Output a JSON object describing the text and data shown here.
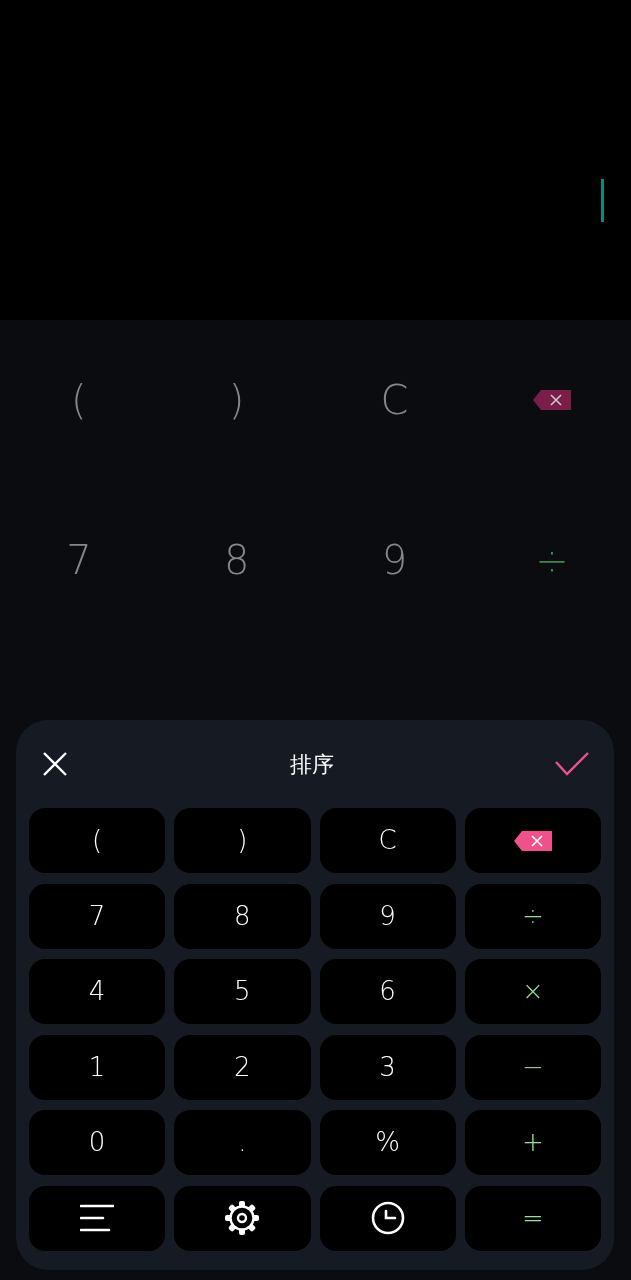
{
  "background_keypad": {
    "keys": [
      {
        "kind": "text",
        "label": "("
      },
      {
        "kind": "text",
        "label": ")"
      },
      {
        "kind": "text",
        "label": "C"
      },
      {
        "kind": "backspace"
      },
      {
        "kind": "text",
        "label": "7"
      },
      {
        "kind": "text",
        "label": "8"
      },
      {
        "kind": "text",
        "label": "9"
      },
      {
        "kind": "op",
        "label": "÷"
      }
    ]
  },
  "sheet": {
    "title": "排序",
    "keys": [
      {
        "kind": "text",
        "label": "("
      },
      {
        "kind": "text",
        "label": ")"
      },
      {
        "kind": "text",
        "label": "C"
      },
      {
        "kind": "backspace"
      },
      {
        "kind": "text",
        "label": "7"
      },
      {
        "kind": "text",
        "label": "8"
      },
      {
        "kind": "text",
        "label": "9"
      },
      {
        "kind": "op",
        "label": "÷"
      },
      {
        "kind": "text",
        "label": "4"
      },
      {
        "kind": "text",
        "label": "5"
      },
      {
        "kind": "text",
        "label": "6"
      },
      {
        "kind": "op",
        "label": "×"
      },
      {
        "kind": "text",
        "label": "1"
      },
      {
        "kind": "text",
        "label": "2"
      },
      {
        "kind": "text",
        "label": "3"
      },
      {
        "kind": "op",
        "label": "−"
      },
      {
        "kind": "text",
        "label": "0"
      },
      {
        "kind": "text",
        "label": "."
      },
      {
        "kind": "text",
        "label": "%"
      },
      {
        "kind": "op",
        "label": "+"
      },
      {
        "kind": "menu"
      },
      {
        "kind": "settings"
      },
      {
        "kind": "history"
      },
      {
        "kind": "op",
        "label": "="
      }
    ]
  }
}
